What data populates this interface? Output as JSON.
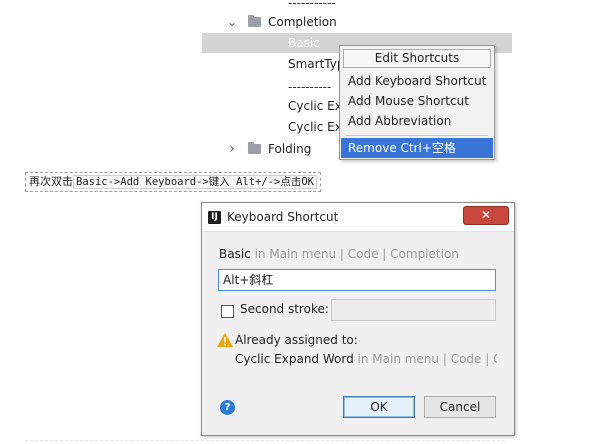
{
  "tree": {
    "top_dashes": "-----------",
    "completion_label": "Completion",
    "basic_label": "Basic",
    "smarttype_label": "SmartTyp",
    "mid_dashes": "----------",
    "cyclic1_label": "Cyclic Ex",
    "cyclic2_label": "Cyclic Ex",
    "folding_label": "Folding",
    "expanded_chevron": "⌄",
    "collapsed_chevron": "›"
  },
  "context_menu": {
    "title": "Edit Shortcuts",
    "items": [
      {
        "label": "Add Keyboard Shortcut"
      },
      {
        "label": "Add Mouse Shortcut"
      },
      {
        "label": "Add Abbreviation"
      },
      {
        "label": "Remove Ctrl+空格"
      }
    ]
  },
  "instruction": {
    "prefix": "再次双击",
    "code": "Basic->Add Keyboard->键入 Alt+/->点击OK"
  },
  "dialog": {
    "title": "Keyboard Shortcut",
    "close_glyph": "✕",
    "icon_glyph": "IJ",
    "path_action": "Basic",
    "path_context": " in Main menu | Code | Completion",
    "shortcut_value": "Alt+斜杠",
    "second_stroke_label": "Second stroke:",
    "second_stroke_checked": false,
    "warning_text": "Already assigned to:",
    "conflict_action": "Cyclic Expand Word",
    "conflict_context": " in Main menu | Code | C",
    "help_glyph": "?",
    "ok_label": "OK",
    "cancel_label": "Cancel"
  },
  "colors": {
    "menu_highlight": "#3875d7",
    "selected_row": "#d4d4d4",
    "input_focus_border": "#4a90d9",
    "close_button": "#c9483d",
    "warning": "#f0a30a"
  }
}
